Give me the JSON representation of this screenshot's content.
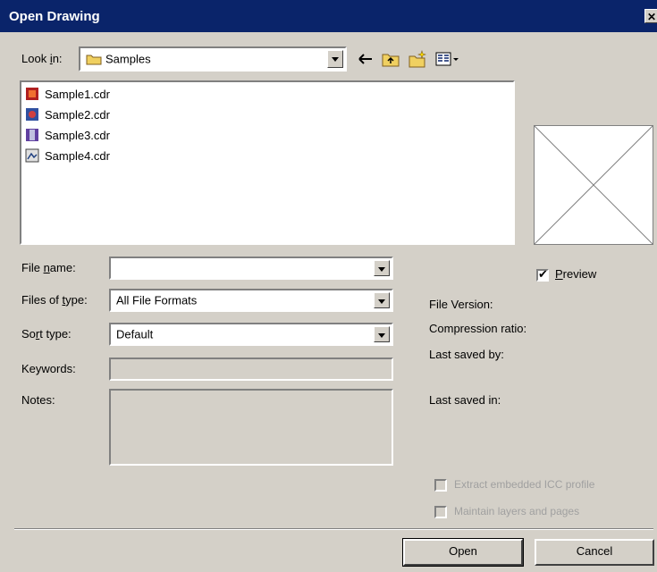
{
  "window": {
    "title": "Open Drawing",
    "close_symbol": "✕"
  },
  "look_in": {
    "label": "Look in:",
    "value": "Samples"
  },
  "files": [
    {
      "name": "Sample1.cdr"
    },
    {
      "name": "Sample2.cdr"
    },
    {
      "name": "Sample3.cdr"
    },
    {
      "name": "Sample4.cdr"
    }
  ],
  "form": {
    "file_name": {
      "label": "File name:",
      "value": ""
    },
    "files_of_type": {
      "label": "Files of type:",
      "value": "All File Formats"
    },
    "sort_type": {
      "label": "Sort type:",
      "value": "Default"
    },
    "keywords": {
      "label": "Keywords:",
      "value": ""
    },
    "notes": {
      "label": "Notes:",
      "value": ""
    }
  },
  "preview": {
    "label": "Preview",
    "checked": true
  },
  "info": {
    "file_version": "File Version:",
    "compression_ratio": "Compression ratio:",
    "last_saved_by": "Last saved by:",
    "last_saved_in": "Last saved in:"
  },
  "options": {
    "extract_icc": "Extract embedded ICC profile",
    "maintain_layers": "Maintain layers and pages"
  },
  "buttons": {
    "open": "Open",
    "cancel": "Cancel"
  },
  "icons": {
    "back": "back-arrow-icon",
    "up_folder": "up-folder-icon",
    "new_folder": "new-folder-icon",
    "view_menu": "view-menu-icon"
  },
  "colors": {
    "title_bar": "#0a246a",
    "dialog_face": "#d4d0c8"
  }
}
